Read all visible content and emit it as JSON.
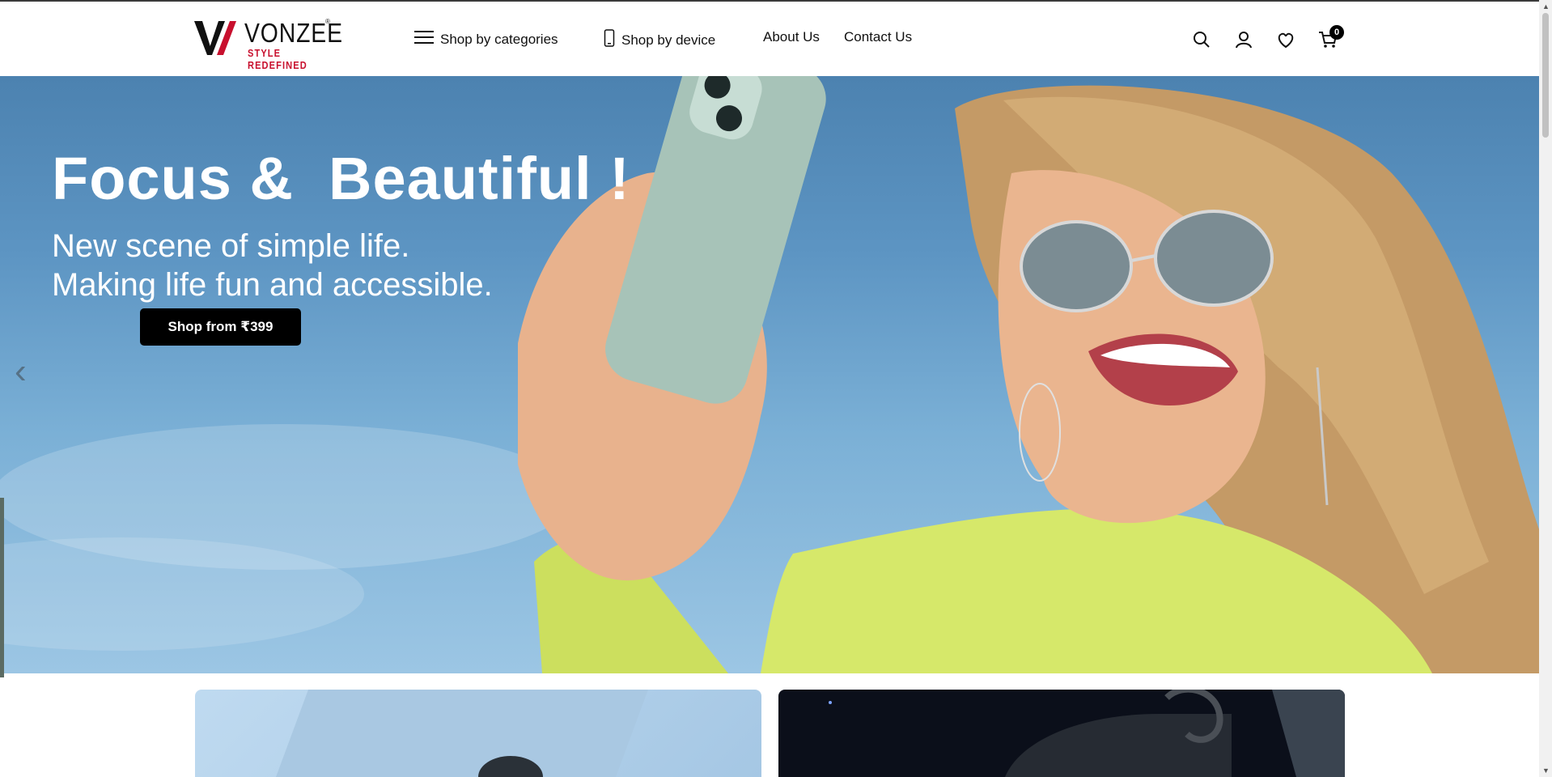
{
  "brand": {
    "name": "VONZEE",
    "tagline": "STYLE REDEFINED",
    "registered": "®",
    "accent": "#c8102e"
  },
  "nav": {
    "categories": "Shop by categories",
    "device": "Shop by device",
    "about": "About Us",
    "contact": "Contact Us"
  },
  "header_icons": {
    "search": "search-icon",
    "account": "user-icon",
    "wishlist": "heart-icon",
    "cart": "cart-icon",
    "cart_count": "0"
  },
  "hero": {
    "title": "Focus &  Beautiful !",
    "subtitle_line1": "New scene of simple life.",
    "subtitle_line2": "Making life fun and accessible.",
    "cta": "Shop from ₹399",
    "prev_arrow": "‹"
  },
  "colors": {
    "cta_bg": "#000000",
    "sky": "#5d95c3",
    "shirt": "#d6e86a"
  }
}
